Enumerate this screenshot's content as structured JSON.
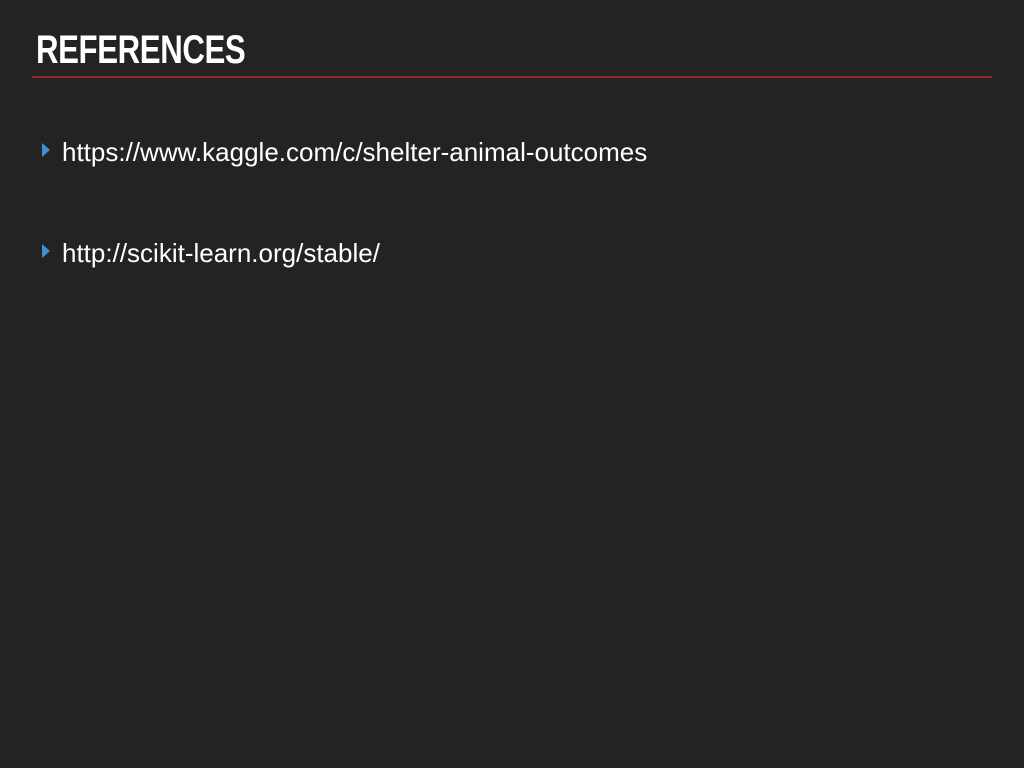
{
  "slide": {
    "title": "REFERENCES",
    "bullets": [
      {
        "text": "https://www.kaggle.com/c/shelter-animal-outcomes"
      },
      {
        "text": "http://scikit-learn.org/stable/"
      }
    ]
  },
  "colors": {
    "background": "#232323",
    "title": "#ffffff",
    "rule": "#8b2a2a",
    "bullet_marker": "#3d8fd6",
    "text": "#ffffff"
  },
  "icons": {
    "bullet": "triangle-right-icon"
  }
}
